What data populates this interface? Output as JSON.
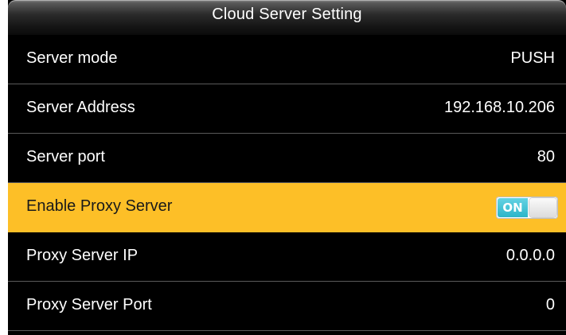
{
  "title": "Cloud Server Setting",
  "rows": [
    {
      "label": "Server mode",
      "value": "PUSH"
    },
    {
      "label": "Server Address",
      "value": "192.168.10.206"
    },
    {
      "label": "Server port",
      "value": "80"
    },
    {
      "label": "Enable Proxy Server",
      "toggle_label": "ON",
      "toggle_state": "on",
      "selected": true
    },
    {
      "label": "Proxy Server IP",
      "value": "0.0.0.0"
    },
    {
      "label": "Proxy Server Port",
      "value": "0"
    }
  ],
  "colors": {
    "selected_row": "#fdbf27",
    "toggle_on": "#2cb5c9",
    "background": "#000000"
  }
}
